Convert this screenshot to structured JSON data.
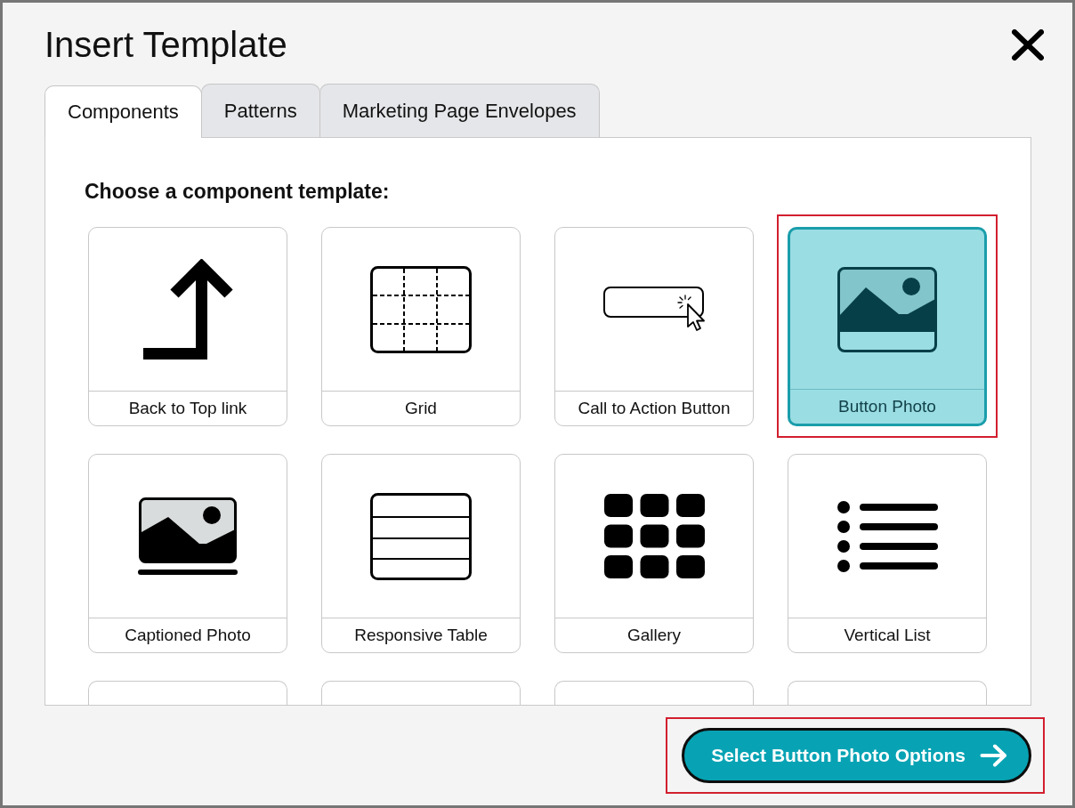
{
  "dialog": {
    "title": "Insert Template"
  },
  "tabs": [
    {
      "label": "Components",
      "selected": true
    },
    {
      "label": "Patterns",
      "selected": false
    },
    {
      "label": "Marketing Page Envelopes",
      "selected": false
    }
  ],
  "panel": {
    "heading": "Choose a component template:",
    "templates": [
      {
        "kind": "arrow",
        "label": "Back to Top link",
        "selected": false,
        "highlighted": false
      },
      {
        "kind": "grid",
        "label": "Grid",
        "selected": false,
        "highlighted": false
      },
      {
        "kind": "button",
        "label": "Call to Action Button",
        "selected": false,
        "highlighted": false
      },
      {
        "kind": "photo",
        "label": "Button Photo",
        "selected": true,
        "highlighted": true
      },
      {
        "kind": "captioned",
        "label": "Captioned Photo",
        "selected": false,
        "highlighted": false
      },
      {
        "kind": "table",
        "label": "Responsive Table",
        "selected": false,
        "highlighted": false
      },
      {
        "kind": "gallery",
        "label": "Gallery",
        "selected": false,
        "highlighted": false
      },
      {
        "kind": "list",
        "label": "Vertical List",
        "selected": false,
        "highlighted": false
      },
      {
        "selected": false,
        "highlighted": false
      },
      {
        "selected": false,
        "highlighted": false
      },
      {
        "selected": false,
        "highlighted": false
      },
      {
        "selected": false,
        "highlighted": false
      }
    ]
  },
  "action_button": {
    "label": "Select Button Photo Options",
    "highlighted": true
  }
}
